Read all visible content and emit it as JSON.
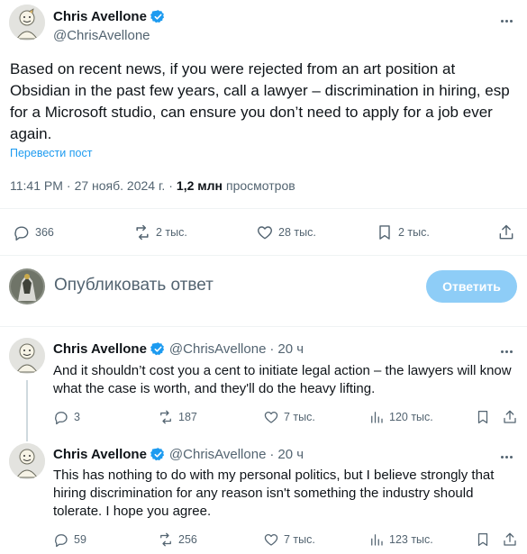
{
  "colors": {
    "accent": "#1d9bf0",
    "verified": "#1d9bf0",
    "secondary_text": "#536471",
    "reply_button_bg": "#8ecdf7"
  },
  "main_tweet": {
    "author_name": "Chris Avellone",
    "author_handle": "@ChrisAvellone",
    "avatar_icon": "vault-boy-avatar",
    "text": "Based on recent news, if you were rejected from an art position at Obsidian in the past few years, call a lawyer – discrimination in hiring, esp for a Microsoft studio, can ensure you don’t need to apply for a job ever again.",
    "translate_label": "Перевести пост",
    "time": "11:41 PM",
    "date": "27 нояб. 2024 г.",
    "separator": "·",
    "views_count": "1,2 млн",
    "views_label": "просмотров",
    "actions": {
      "replies": "366",
      "reposts": "2 тыс.",
      "likes": "28 тыс.",
      "bookmarks": "2 тыс."
    }
  },
  "composer": {
    "placeholder": "Опубликовать ответ",
    "reply_button_label": "Ответить"
  },
  "replies": [
    {
      "author_name": "Chris Avellone",
      "author_handle": "@ChrisAvellone",
      "separator": "·",
      "time": "20 ч",
      "text": "And it shouldn’t cost you a cent to initiate legal action – the lawyers will know what the case is worth, and they'll do the heavy lifting.",
      "replies": "3",
      "reposts": "187",
      "likes": "7 тыс.",
      "views": "120 тыс."
    },
    {
      "author_name": "Chris Avellone",
      "author_handle": "@ChrisAvellone",
      "separator": "·",
      "time": "20 ч",
      "text": "This has nothing to do with my personal politics, but I believe strongly that hiring discrimination for any reason isn't something the industry should tolerate. I hope you agree.",
      "replies": "59",
      "reposts": "256",
      "likes": "7 тыс.",
      "views": "123 тыс."
    }
  ]
}
